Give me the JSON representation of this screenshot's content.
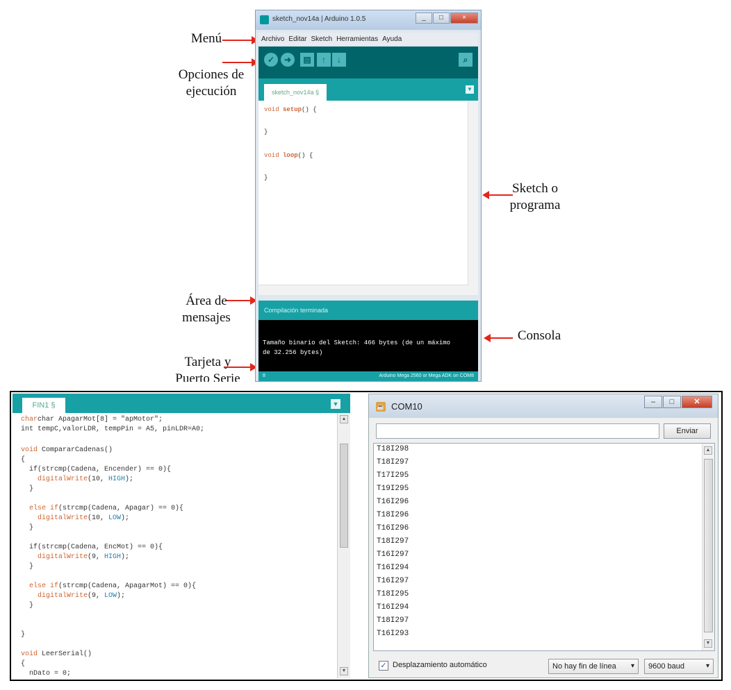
{
  "annotations": {
    "menu": "Menú",
    "options_line1": "Opciones de",
    "options_line2": "ejecución",
    "sketch_line1": "Sketch o",
    "sketch_line2": "programa",
    "messages_line1": "Área de",
    "messages_line2": "mensajes",
    "console": "Consola",
    "board_line1": "Tarjeta y",
    "board_line2": "Puerto Serie"
  },
  "ide_window": {
    "title": "sketch_nov14a | Arduino 1.0.5",
    "menu": [
      "Archivo",
      "Editar",
      "Sketch",
      "Herramientas",
      "Ayuda"
    ],
    "tab": "sketch_nov14a §",
    "code": {
      "setup_kw": "void",
      "setup_fn": "setup",
      "setup_rest": "() {",
      "close1": "}",
      "loop_kw": "void",
      "loop_fn": "loop",
      "loop_rest": "() {",
      "close2": "}"
    },
    "message": "Compilación terminada",
    "console_line1": "Tamaño binario del Sketch: 466 bytes (de un máximo",
    "console_line2": "de 32.256 bytes)",
    "status_left": "8",
    "status_right": "Arduino Mega 2560 or Mega ADK on COM8"
  },
  "code_editor": {
    "tab": "FIN1 §",
    "lines": {
      "l1": "char ApagarMot[8] = \"apMotor\";",
      "l2": "int tempC,valorLDR, tempPin = A5, pinLDR=A0;",
      "l4_kw": "void",
      "l4_rest": " CompararCadenas()",
      "l5": "{",
      "l6": "  if(strcmp(Cadena, Encender) == 0){",
      "l7_fn": "    digitalWrite",
      "l7_a": "(10, ",
      "l7_b": "HIGH",
      "l7_c": ");",
      "l8": "  }",
      "l10_kw": "  else if",
      "l10_rest": "(strcmp(Cadena, Apagar) == 0){",
      "l11_fn": "    digitalWrite",
      "l11_a": "(10, ",
      "l11_b": "LOW",
      "l11_c": ");",
      "l12": "  }",
      "l14": "  if(strcmp(Cadena, EncMot) == 0){",
      "l15_fn": "    digitalWrite",
      "l15_a": "(9, ",
      "l15_b": "HIGH",
      "l15_c": ");",
      "l16": "  }",
      "l18_kw": "  else if",
      "l18_rest": "(strcmp(Cadena, ApagarMot) == 0){",
      "l19_fn": "    digitalWrite",
      "l19_a": "(9, ",
      "l19_b": "LOW",
      "l19_c": ");",
      "l20": "  }",
      "l23": "}",
      "l25_kw": "void",
      "l25_rest": " LeerSerial()",
      "l26": "{",
      "l27": "  nDato = 0;"
    }
  },
  "serial_monitor": {
    "title": "COM10",
    "send_label": "Enviar",
    "output": [
      "T18I298",
      "T18I297",
      "T17I295",
      "T19I295",
      "T16I296",
      "T18I296",
      "T16I296",
      "T18I297",
      "T16I297",
      "T16I294",
      "T16I297",
      "T18I295",
      "T16I294",
      "T18I297",
      "T16I293"
    ],
    "autoscroll_label": "Desplazamiento automático",
    "line_ending": "No hay fin de línea",
    "baud": "9600 baud"
  },
  "colors": {
    "arduino_teal": "#17a1a5",
    "arduino_dark": "#006468",
    "arrow_red": "#e2261c"
  }
}
